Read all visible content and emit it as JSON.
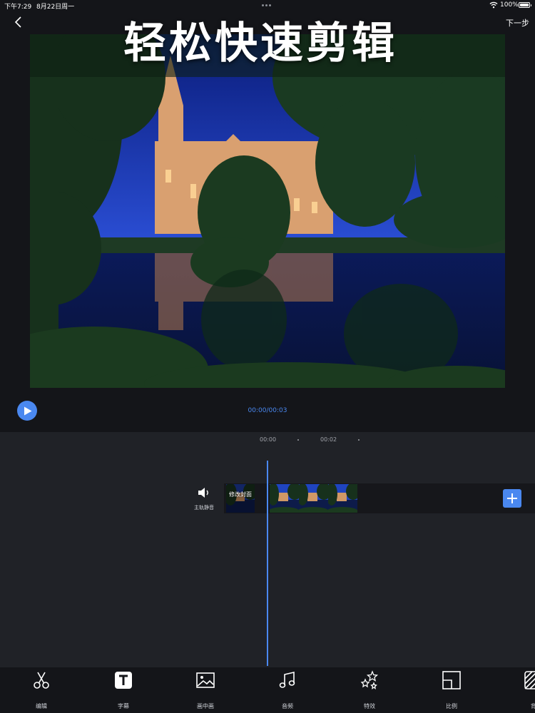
{
  "status_bar": {
    "time": "下午7:29",
    "date": "8月22日周一",
    "battery": "100%"
  },
  "nav": {
    "next_label": "下一步"
  },
  "headline": "轻松快速剪辑",
  "playback": {
    "time_readout": "00:00/00:03"
  },
  "timeline": {
    "ruler": [
      "00:00",
      "00:02"
    ],
    "mute_label": "主轨静音",
    "cover_label": "修改封面"
  },
  "toolbar": {
    "items": [
      {
        "label": "编辑",
        "icon": "scissors-icon"
      },
      {
        "label": "字幕",
        "icon": "text-t-icon"
      },
      {
        "label": "画中画",
        "icon": "picture-in-picture-icon"
      },
      {
        "label": "音频",
        "icon": "music-note-icon"
      },
      {
        "label": "特效",
        "icon": "sparkle-stars-icon"
      },
      {
        "label": "比例",
        "icon": "aspect-ratio-icon"
      },
      {
        "label": "背",
        "icon": "background-hatch-icon"
      }
    ]
  },
  "colors": {
    "accent": "#4a88f0",
    "background": "#141519",
    "timeline_panel": "#202227"
  }
}
